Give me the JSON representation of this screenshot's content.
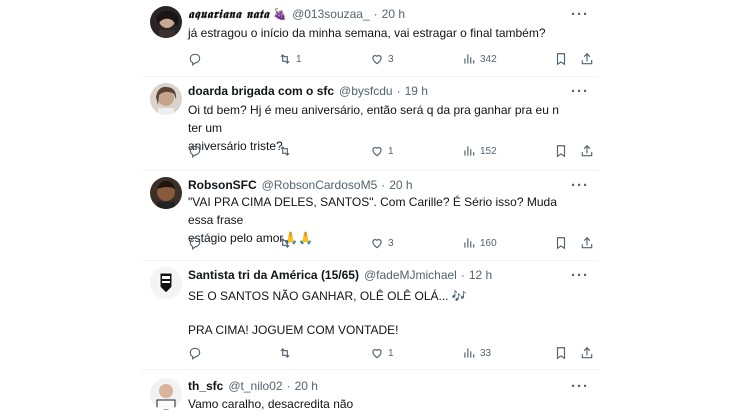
{
  "tweets": [
    {
      "display_name": "𝖆𝖖𝖚𝖆𝖗𝖎𝖆𝖓𝖆 𝖓𝖆𝖙𝖆",
      "badge": "🍇",
      "handle": "@013souzaa_",
      "time": "20 h",
      "text_lines": [
        "já estragou o início da minha semana, vai estragar o final também?"
      ],
      "stats": {
        "replies": "",
        "retweets": "1",
        "likes": "3",
        "views": "342"
      }
    },
    {
      "display_name": "doarda brigada com o sfc",
      "handle": "@bysfcdu",
      "time": "19 h",
      "text_lines": [
        "Oi td bem? Hj é meu aniversário, então será q da pra ganhar pra eu n ter um",
        "aniversário triste?"
      ],
      "stats": {
        "replies": "",
        "retweets": "",
        "likes": "1",
        "views": "152"
      }
    },
    {
      "display_name": "RobsonSFC",
      "handle": "@RobsonCardosoM5",
      "time": "20 h",
      "text_lines": [
        "\"VAI PRA CIMA DELES, SANTOS\". Com Carille? É Sério isso? Muda essa frase",
        "estágio pelo amor🙏🙏"
      ],
      "stats": {
        "replies": "",
        "retweets": "",
        "likes": "3",
        "views": "160"
      }
    },
    {
      "display_name": "Santista tri da América (15/65)",
      "handle": "@fadeMJmichael",
      "time": "12 h",
      "text_lines": [
        "SE O SANTOS NÃO GANHAR, OLÊ OLÊ OLÁ... 🎶",
        "",
        "PRA CIMA! JOGUEM COM VONTADE!"
      ],
      "stats": {
        "replies": "",
        "retweets": "",
        "likes": "1",
        "views": "33"
      }
    },
    {
      "display_name": "th_sfc",
      "handle": "@t_nilo02",
      "time": "20 h",
      "text_lines": [
        "Vamo caralho, desacredita não"
      ],
      "stats": {
        "replies": "",
        "retweets": "",
        "likes": "",
        "views": ""
      }
    }
  ],
  "separator": "·",
  "colors": {
    "text": "#0f1419",
    "secondary": "#536471",
    "divider": "#eff3f4"
  },
  "icons": [
    "avatar",
    "more-icon",
    "reply-icon",
    "retweet-icon",
    "like-icon",
    "views-icon",
    "bookmark-icon",
    "share-icon"
  ]
}
